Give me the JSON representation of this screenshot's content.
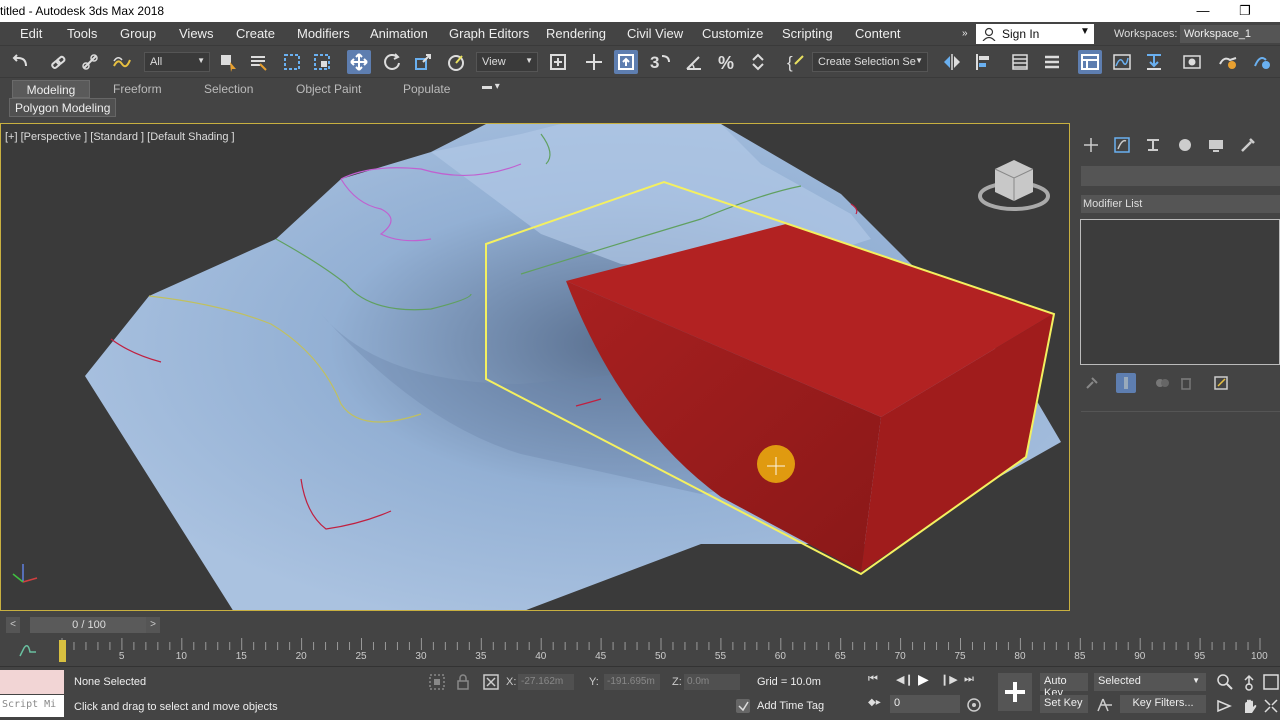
{
  "window": {
    "title": "titled - Autodesk 3ds Max 2018",
    "minimize": "—",
    "maximize": "❐"
  },
  "menu": [
    "Edit",
    "Tools",
    "Group",
    "Views",
    "Create",
    "Modifiers",
    "Animation",
    "Graph Editors",
    "Rendering",
    "Civil View",
    "Customize",
    "Scripting",
    "Content"
  ],
  "account": {
    "sign_in": "Sign In",
    "workspaces_label": "Workspaces:",
    "workspace": "Workspace_1"
  },
  "toolbar": {
    "filter": "All",
    "ref_coord": "View",
    "selection_set": "Create Selection Se"
  },
  "ribbon": {
    "tabs": [
      "Modeling",
      "Freeform",
      "Selection",
      "Object Paint",
      "Populate"
    ],
    "active_tab": "Modeling",
    "sub_tab": "Polygon Modeling"
  },
  "viewport": {
    "label": "[+] [Perspective ] [Standard ] [Default Shading ]"
  },
  "command_panel": {
    "modifier_list": "Modifier List"
  },
  "time_slider": {
    "value": "0 / 100",
    "prev": "<",
    "next": ">"
  },
  "ruler_ticks": [
    "5",
    "10",
    "15",
    "20",
    "25",
    "30",
    "35",
    "40",
    "45",
    "50",
    "55",
    "60",
    "65",
    "70",
    "75",
    "80",
    "85",
    "90",
    "95",
    "100"
  ],
  "status": {
    "maxscript": "Script Mi",
    "selection": "None Selected",
    "prompt": "Click and drag to select and move objects",
    "x_label": "X:",
    "x_value": "-27.162m",
    "y_label": "Y:",
    "y_value": "-191.695m",
    "z_label": "Z:",
    "z_value": "0.0m",
    "grid": "Grid = 10.0m",
    "add_time_tag": "Add Time Tag",
    "auto_key": "Auto Key",
    "set_key": "Set Key",
    "selected": "Selected",
    "key_filters": "Key Filters...",
    "frame": "0"
  },
  "colors": {
    "accent": "#5e7eb0",
    "selection": "#e8e060",
    "box": "#a82020",
    "terrain": "#9fb8d8"
  }
}
